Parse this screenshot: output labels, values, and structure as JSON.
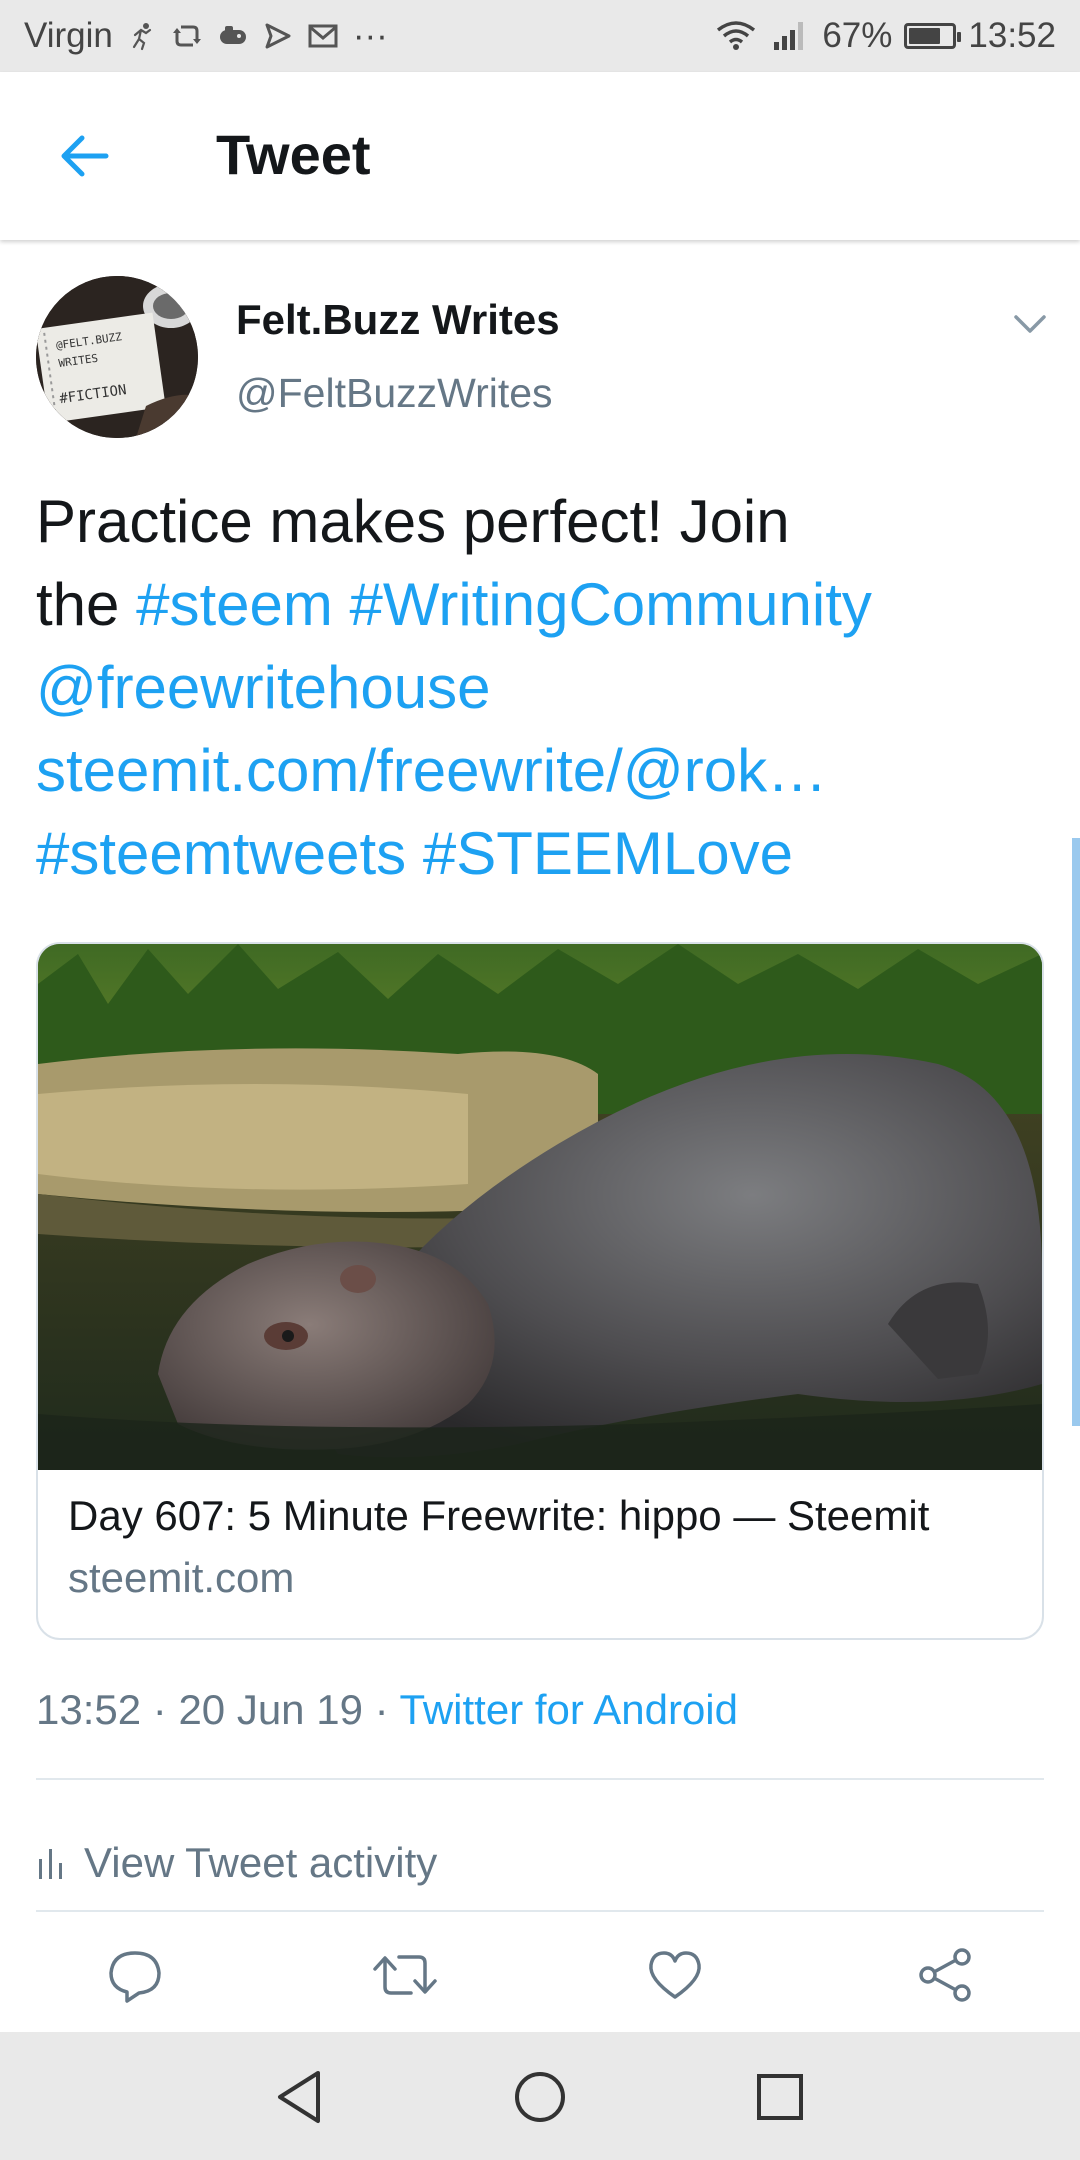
{
  "status_bar": {
    "carrier": "Virgin",
    "notification_icons": [
      "running-icon",
      "sync-icon",
      "game-icon",
      "send-icon",
      "mail-icon",
      "more-icon"
    ],
    "overflow": "···",
    "battery_percent": "67%",
    "battery_level": 0.67,
    "time": "13:52"
  },
  "header": {
    "title": "Tweet"
  },
  "tweet": {
    "author_name": "Felt.Buzz Writes",
    "author_handle": "@FeltBuzzWrites",
    "avatar_text": [
      "@FELT.BUZZ",
      "WRITES",
      "#FICTION"
    ],
    "text": {
      "line1": "Practice makes perfect! Join",
      "line2_prefix": "the ",
      "hashtag_steem": "#steem",
      "hashtag_writing": "#WritingCommunity",
      "mention": "@freewritehouse",
      "url": "steemit.com/freewrite/@rok…",
      "hashtag_steemtweets": "#steemtweets",
      "hashtag_steemlove": "#STEEMLove"
    },
    "card": {
      "title": "Day 607: 5 Minute Freewrite: hippo — Steemit",
      "domain": "steemit.com"
    },
    "meta": {
      "time": "13:52",
      "separator": " · ",
      "date": "20 Jun 19",
      "source": "Twitter for Android"
    },
    "activity_label": "View Tweet activity"
  },
  "colors": {
    "accent": "#1da1f2",
    "secondary_text": "#657786",
    "primary_text": "#14171a",
    "divider": "#e1e8ed"
  },
  "actions": [
    "reply-icon",
    "retweet-icon",
    "like-icon",
    "share-icon"
  ],
  "nav_bar": [
    "back-triangle-icon",
    "home-circle-icon",
    "recents-square-icon"
  ]
}
